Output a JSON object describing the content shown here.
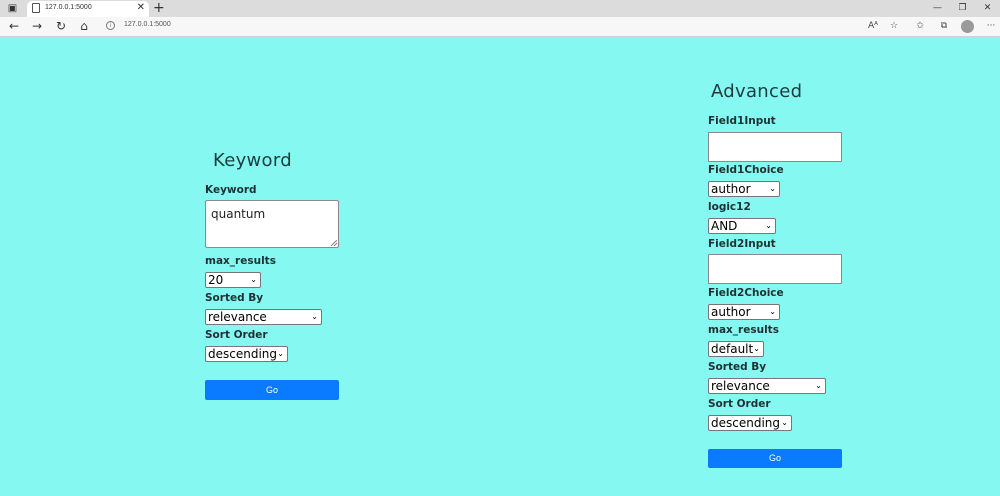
{
  "browser": {
    "tab_title": "127.0.0.1:5000",
    "address": "127.0.0.1:5000",
    "icons": {
      "window_menu": "window-menu-icon",
      "page": "page-icon",
      "close": "close-icon",
      "new_tab": "plus-icon",
      "back": "back-arrow-icon",
      "forward": "forward-arrow-icon",
      "refresh": "refresh-icon",
      "home": "home-icon",
      "info": "info-icon",
      "read_aloud": "read-aloud-icon",
      "favorite_add": "favorite-add-icon",
      "favorites": "favorites-icon",
      "collections": "collections-icon",
      "profile": "profile-avatar-icon",
      "more": "more-icon"
    }
  },
  "keyword_form": {
    "heading": "Keyword",
    "keyword_label": "Keyword",
    "keyword_value": "quantum",
    "max_results_label": "max_results",
    "max_results_value": "20",
    "sorted_by_label": "Sorted By",
    "sorted_by_value": "relevance",
    "sort_order_label": "Sort Order",
    "sort_order_value": "descending",
    "go_label": "Go"
  },
  "advanced_form": {
    "heading": "Advanced",
    "field1_input_label": "Field1Input",
    "field1_input_value": "",
    "field1_choice_label": "Field1Choice",
    "field1_choice_value": "author",
    "logic12_label": "logic12",
    "logic12_value": "AND",
    "field2_input_label": "Field2Input",
    "field2_input_value": "",
    "field2_choice_label": "Field2Choice",
    "field2_choice_value": "author",
    "max_results_label": "max_results",
    "max_results_value": "default",
    "sorted_by_label": "Sorted By",
    "sorted_by_value": "relevance",
    "sort_order_label": "Sort Order",
    "sort_order_value": "descending",
    "go_label": "Go"
  },
  "colors": {
    "page_background": "#85f8f2",
    "button_blue": "#0a7bff",
    "heading_text": "#1e3b3d"
  }
}
